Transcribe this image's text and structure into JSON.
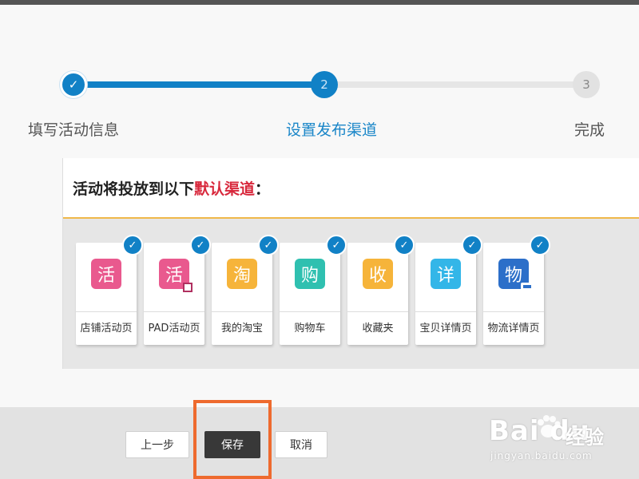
{
  "stepper": {
    "steps": [
      {
        "label": "填写活动信息",
        "state": "done",
        "marker": "✓"
      },
      {
        "label": "设置发布渠道",
        "state": "active",
        "marker": "2"
      },
      {
        "label": "完成",
        "state": "pending",
        "marker": "3"
      }
    ],
    "colors": {
      "active": "#1181c6",
      "pending": "#e2e2e2"
    }
  },
  "panel": {
    "title_prefix": "活动将投放到以下",
    "title_highlight": "默认渠道",
    "title_suffix": "：",
    "highlight_color": "#d8283c",
    "channels": [
      {
        "label": "店铺活动页",
        "glyph": "活",
        "color": "#e9598e",
        "checked": true,
        "icon": "shop-activity-icon"
      },
      {
        "label": "PAD活动页",
        "glyph": "活",
        "color": "#e9598e",
        "checked": true,
        "icon": "pad-activity-icon"
      },
      {
        "label": "我的淘宝",
        "glyph": "淘",
        "color": "#f6b43a",
        "checked": true,
        "icon": "my-taobao-icon"
      },
      {
        "label": "购物车",
        "glyph": "购",
        "color": "#2fc0b0",
        "checked": true,
        "icon": "cart-icon"
      },
      {
        "label": "收藏夹",
        "glyph": "收",
        "color": "#f6b43a",
        "checked": true,
        "icon": "favorites-icon"
      },
      {
        "label": "宝贝详情页",
        "glyph": "详",
        "color": "#33b6e8",
        "checked": true,
        "icon": "item-detail-icon"
      },
      {
        "label": "物流详情页",
        "glyph": "物",
        "color": "#2c6fc9",
        "checked": true,
        "icon": "logistics-detail-icon"
      }
    ]
  },
  "footer": {
    "prev_label": "上一步",
    "save_label": "保存",
    "cancel_label": "取消",
    "highlight_color": "#ee6a2e"
  },
  "watermark": {
    "logo": "Bai du",
    "cn": "经验",
    "url": "jingyan.baidu.com"
  }
}
